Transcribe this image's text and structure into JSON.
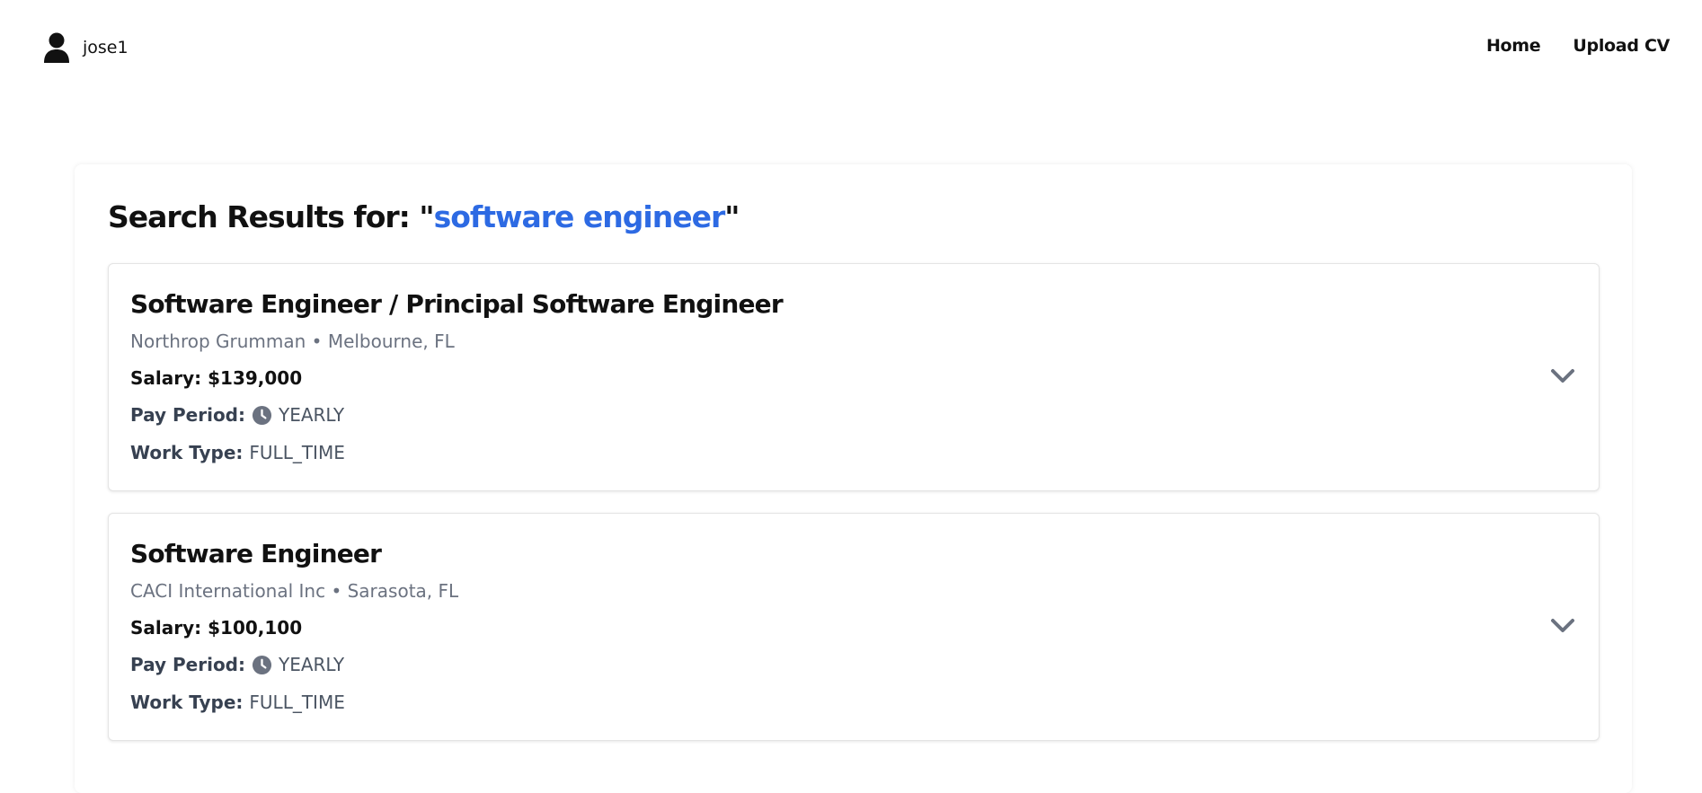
{
  "header": {
    "username": "jose1",
    "nav": [
      {
        "label": "Home"
      },
      {
        "label": "Upload CV"
      }
    ]
  },
  "results": {
    "heading_prefix": "Search Results for: \"",
    "query": "software engineer",
    "heading_suffix": "\"",
    "cards": [
      {
        "title": "Software Engineer / Principal Software Engineer",
        "subtitle": "Northrop Grumman • Melbourne, FL",
        "salary": "Salary: $139,000",
        "pay_period_label": "Pay Period:",
        "pay_period_value": "YEARLY",
        "work_type_label": "Work Type:",
        "work_type_value": "FULL_TIME"
      },
      {
        "title": "Software Engineer",
        "subtitle": "CACI International Inc • Sarasota, FL",
        "salary": "Salary: $100,100",
        "pay_period_label": "Pay Period:",
        "pay_period_value": "YEARLY",
        "work_type_label": "Work Type:",
        "work_type_value": "FULL_TIME"
      }
    ]
  },
  "icons": {
    "user": "user-icon",
    "clock": "clock-icon",
    "expand": "chevron-down-icon"
  },
  "colors": {
    "accent": "#2d6ae3",
    "muted": "#6b7280"
  }
}
